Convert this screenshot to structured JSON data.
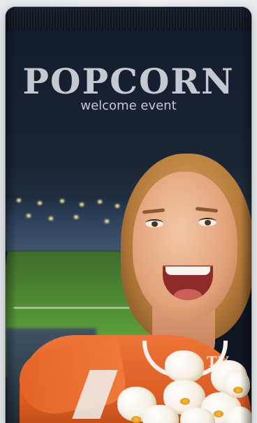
{
  "product": {
    "title": "POPCORN",
    "subtitle": "welcome event",
    "tv_mark": "TV"
  },
  "colors": {
    "bag_background": "#141d2d",
    "title_text": "#c6c9d0",
    "jersey": "#ef7538",
    "pitch": "#4f8a33"
  }
}
